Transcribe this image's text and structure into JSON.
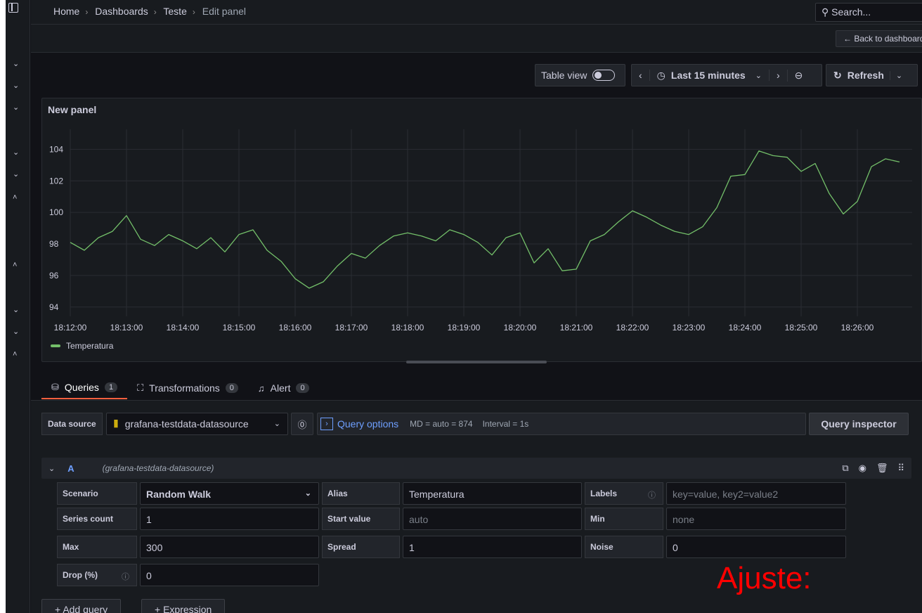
{
  "breadcrumbs": [
    "Home",
    "Dashboards",
    "Teste",
    "Edit panel"
  ],
  "search": {
    "placeholder": "Search..."
  },
  "back_button": "Back to dashboard",
  "toolbar": {
    "table_view": "Table view",
    "time_range": "Last 15 minutes",
    "refresh": "Refresh"
  },
  "panel": {
    "title": "New panel",
    "legend": "Temperatura",
    "series_color": "#73bf69"
  },
  "chart_data": {
    "type": "line",
    "title": "New panel",
    "y_ticks": [
      104,
      102,
      100,
      98,
      96,
      94
    ],
    "x_ticks": [
      "18:12:00",
      "18:13:00",
      "18:14:00",
      "18:15:00",
      "18:16:00",
      "18:17:00",
      "18:18:00",
      "18:19:00",
      "18:20:00",
      "18:21:00",
      "18:22:00",
      "18:23:00",
      "18:24:00",
      "18:25:00",
      "18:26:00"
    ],
    "ylim": [
      93.5,
      105
    ],
    "grid": true,
    "legend_position": "bottom-left",
    "series": [
      {
        "name": "Temperatura",
        "x": [
          "18:12:00",
          "18:12:15",
          "18:12:30",
          "18:12:45",
          "18:13:00",
          "18:13:15",
          "18:13:30",
          "18:13:45",
          "18:14:00",
          "18:14:15",
          "18:14:30",
          "18:14:45",
          "18:15:00",
          "18:15:15",
          "18:15:30",
          "18:15:45",
          "18:16:00",
          "18:16:15",
          "18:16:30",
          "18:16:45",
          "18:17:00",
          "18:17:15",
          "18:17:30",
          "18:17:45",
          "18:18:00",
          "18:18:15",
          "18:18:30",
          "18:18:45",
          "18:19:00",
          "18:19:15",
          "18:19:30",
          "18:19:45",
          "18:20:00",
          "18:20:15",
          "18:20:30",
          "18:20:45",
          "18:21:00",
          "18:21:15",
          "18:21:30",
          "18:21:45",
          "18:22:00",
          "18:22:15",
          "18:22:30",
          "18:22:45",
          "18:23:00",
          "18:23:15",
          "18:23:30",
          "18:23:45",
          "18:24:00",
          "18:24:15",
          "18:24:30",
          "18:24:45",
          "18:25:00",
          "18:25:15",
          "18:25:30",
          "18:25:45",
          "18:26:00",
          "18:26:15",
          "18:26:30",
          "18:26:45"
        ],
        "values": [
          98.1,
          97.6,
          98.4,
          98.8,
          99.8,
          98.3,
          97.9,
          98.6,
          98.2,
          97.7,
          98.4,
          97.5,
          98.6,
          98.9,
          97.6,
          96.9,
          95.8,
          95.2,
          95.6,
          96.6,
          97.4,
          97.1,
          97.9,
          98.5,
          98.7,
          98.5,
          98.2,
          98.9,
          98.6,
          98.1,
          97.3,
          98.4,
          98.7,
          96.8,
          97.7,
          96.3,
          96.4,
          98.2,
          98.6,
          99.4,
          100.1,
          99.7,
          99.2,
          98.8,
          98.6,
          99.1,
          100.3,
          102.3,
          102.4,
          103.9,
          103.6,
          103.5,
          102.6,
          103.1,
          101.2,
          99.9,
          100.7,
          102.9,
          103.4,
          103.2
        ]
      }
    ]
  },
  "tabs": [
    {
      "label": "Queries",
      "count": "1"
    },
    {
      "label": "Transformations",
      "count": "0"
    },
    {
      "label": "Alert",
      "count": "0"
    }
  ],
  "datasource": {
    "label": "Data source",
    "value": "grafana-testdata-datasource",
    "query_options": "Query options",
    "md": "MD = auto = 874",
    "interval": "Interval = 1s",
    "inspector": "Query inspector"
  },
  "query": {
    "ref": "A",
    "ds": "(grafana-testdata-datasource)",
    "scenario_label": "Scenario",
    "scenario": "Random Walk",
    "alias_label": "Alias",
    "alias": "Temperatura",
    "labels_label": "Labels",
    "labels_placeholder": "key=value, key2=value2",
    "series_count_label": "Series count",
    "series_count": "1",
    "start_value_label": "Start value",
    "start_value_placeholder": "auto",
    "min_label": "Min",
    "min_placeholder": "none",
    "max_label": "Max",
    "max": "300",
    "spread_label": "Spread",
    "spread": "1",
    "noise_label": "Noise",
    "noise": "0",
    "drop_label": "Drop (%)",
    "drop": "0"
  },
  "buttons": {
    "add_query": "Add query",
    "expression": "Expression"
  },
  "annotation": "Ajuste:"
}
